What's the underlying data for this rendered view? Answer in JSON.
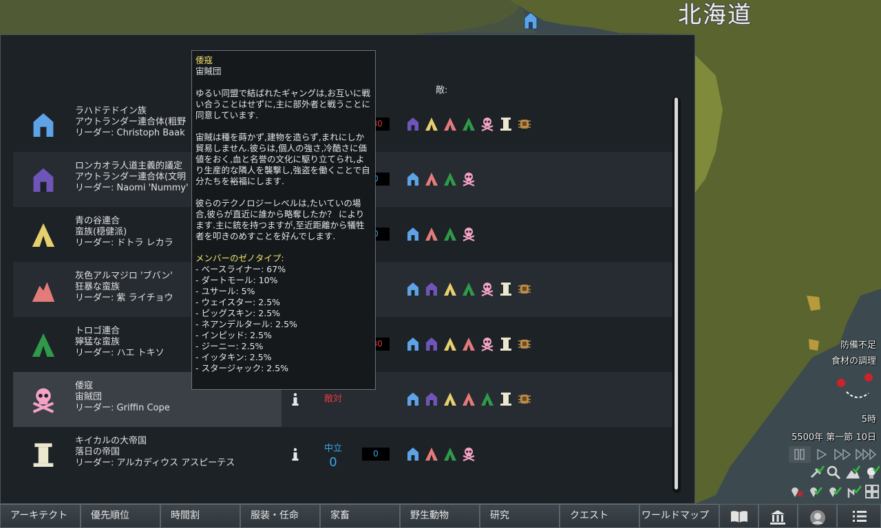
{
  "map": {
    "label": "北海道",
    "colors": {
      "sea": "#3c4a50",
      "land": "#59642f",
      "land_dark": "#4a5328"
    }
  },
  "factions_window": {
    "enemy_header": "敵:",
    "factions": [
      {
        "icon": "house-icon",
        "color": "#5ea3e6",
        "name": "ラハドテドイン族",
        "type": "アウトランダー連合体(粗野",
        "leader": "リーダー: Christoph Baak",
        "relation": "",
        "goodwill_value": "",
        "goodwill": "-80",
        "goodwill_color": "#e03a3a",
        "enemies": [
          "house-purple-icon",
          "tent-yellow-icon",
          "tent-pink-icon",
          "tent-green-icon",
          "skull-icon",
          "pillar-icon",
          "insect-hive-icon"
        ]
      },
      {
        "icon": "house-icon",
        "color": "#6f55b8",
        "name": "ロンカオラ人道主義的議定",
        "type": "アウトランダー連合体(文明",
        "leader": "リーダー: Naomi 'Nummy' S",
        "relation": "",
        "goodwill_value": "",
        "goodwill": "0",
        "goodwill_color": "#39a7e8",
        "enemies": [
          "house-blue-icon",
          "tent-pink-icon",
          "tent-green-icon",
          "skull-icon"
        ]
      },
      {
        "icon": "tent-icon",
        "color": "#e7cf6e",
        "name": "青の谷連合",
        "type": "蛮族(穏健派)",
        "leader": "リーダー: ドトラ レカラ",
        "relation": "",
        "goodwill_value": "",
        "goodwill": "0",
        "goodwill_color": "#39a7e8",
        "enemies": [
          "house-blue-icon",
          "tent-pink-icon",
          "tent-green-icon",
          "skull-icon"
        ]
      },
      {
        "icon": "mountain-icon",
        "color": "#e37b7b",
        "name": "灰色アルマジロ 'ブバン'",
        "type": "狂暴な蛮族",
        "leader": "リーダー: 紫 ライチョウ",
        "relation": "",
        "goodwill_value": "",
        "goodwill": "",
        "goodwill_color": "#e03a3a",
        "enemies": [
          "house-blue-icon",
          "house-purple-icon",
          "tent-yellow-icon",
          "tent-green-icon",
          "skull-icon",
          "pillar-icon",
          "insect-hive-icon"
        ]
      },
      {
        "icon": "tent-icon",
        "color": "#2e9a4a",
        "name": "トロゴ連合",
        "type": "獰猛な蛮族",
        "leader": "リーダー: ハエ トキソ",
        "relation": "",
        "goodwill_value": "",
        "goodwill": "-80",
        "goodwill_color": "#e03a3a",
        "enemies": [
          "house-blue-icon",
          "house-purple-icon",
          "tent-yellow-icon",
          "tent-pink-icon",
          "skull-icon",
          "pillar-icon",
          "insect-hive-icon"
        ]
      },
      {
        "icon": "skull-icon",
        "color": "#f4a3c6",
        "name": "倭寇",
        "type": "宙賊団",
        "leader": "リーダー: Griffin Cope",
        "relation": "敵対",
        "relation_color": "#e03a3a",
        "goodwill_value": "",
        "goodwill": "",
        "goodwill_color": "#e03a3a",
        "enemies": [
          "house-blue-icon",
          "house-purple-icon",
          "tent-yellow-icon",
          "tent-pink-icon",
          "tent-green-icon",
          "pillar-icon",
          "insect-hive-icon"
        ]
      },
      {
        "icon": "pillar-icon",
        "color": "#ece7cf",
        "name": "キイカルの大帝国",
        "type": "落日の帝国",
        "leader": "リーダー: アルカディウス アスピーテス",
        "relation": "中立",
        "relation_color": "#39a7e8",
        "goodwill_value": "0",
        "goodwill": "0",
        "goodwill_color": "#39a7e8",
        "enemies": [
          "house-blue-icon",
          "tent-pink-icon",
          "tent-green-icon",
          "skull-icon"
        ]
      }
    ]
  },
  "tooltip": {
    "title": "倭寇",
    "subtitle": "宙賊団",
    "para1": "ゆるい同盟で結ばれたギャングは,お互いに戦い合うことはせずに,主に部外者と戦うことに同意しています.",
    "para2": "宙賊は種を蒔かず,建物を造らず,まれにしか貿易しません.彼らは,個人の強さ,冷酷さに価値をおく,血と名誉の文化に駆り立てられ,より生産的な隣人を襲撃し,強盗を働くことで自分たちを裕福にします.",
    "para3": "彼らのテクノロジーレベルは,たいていの場合,彼らが直近に誰から略奪したか？ によります.主に銃を持つますが,至近距離から犠牲者を叩きのめすことを好んでします.",
    "xeno_header": "メンバーのゼノタイプ:",
    "xenotypes": [
      "- ベースライナー: 67%",
      "- ダートモール: 10%",
      "- ユサール: 5%",
      "- ウェイスター: 2.5%",
      "- ピッグスキン: 2.5%",
      "- ネアンデルタール: 2.5%",
      "- インピッド: 2.5%",
      "- ジーニー: 2.5%",
      "- イッタキン: 2.5%",
      "- スタージャック: 2.5%"
    ]
  },
  "hud": {
    "alerts": [
      "防備不足",
      "食材の調理"
    ],
    "time": "5時",
    "date": "5500年 第一節 10日",
    "speed_icons": [
      "pause-icon",
      "play-normal-icon",
      "play-fast-icon",
      "play-superfast-icon"
    ],
    "toggles_row1": [
      "auto-rebuild-icon",
      "zoom-icon",
      "terrain-icon",
      "lightbulb-icon"
    ],
    "toggles_row2": [
      "danger-off-icon",
      "map-marker-check-icon",
      "map-marker-check-icon",
      "auto-home-icon",
      "grid-icon"
    ]
  },
  "bottom_bar": {
    "tabs": [
      "アーキテクト",
      "優先順位",
      "時間割",
      "服装・任命",
      "家畜",
      "野生動物",
      "研究",
      "クエスト",
      "ワールドマップ"
    ],
    "icon_tabs": [
      "book-icon",
      "factions-icon",
      "ideology-icon",
      "menu-icon"
    ]
  }
}
